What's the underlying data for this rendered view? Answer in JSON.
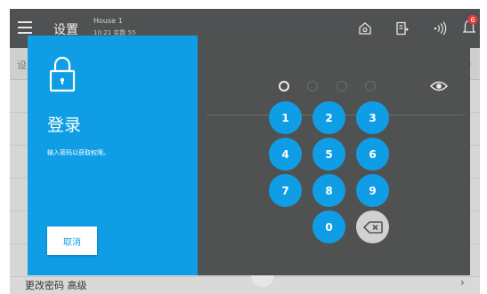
{
  "topbar": {
    "title": "设置",
    "device_name": "House 1",
    "device_sub": "10:21  实数 55",
    "notification_count": "6"
  },
  "background": {
    "search_label": "设",
    "bottom_item_label": "更改密码 高级"
  },
  "login": {
    "title": "登录",
    "hint": "输入密码以获取权限。",
    "cancel_label": "取消"
  },
  "keypad": {
    "keys": [
      "1",
      "2",
      "3",
      "4",
      "5",
      "6",
      "7",
      "8",
      "9",
      "0"
    ],
    "digits_entered": 0,
    "pin_length": 4
  },
  "colors": {
    "accent": "#0f9ee6",
    "panel_dark": "#505151",
    "topbar": "#4f5152",
    "notification": "#e53935"
  },
  "icons": [
    "menu-icon",
    "lock-icon",
    "eye-icon",
    "backspace-icon",
    "home-icon",
    "document-icon",
    "wireless-icon",
    "bell-icon"
  ]
}
